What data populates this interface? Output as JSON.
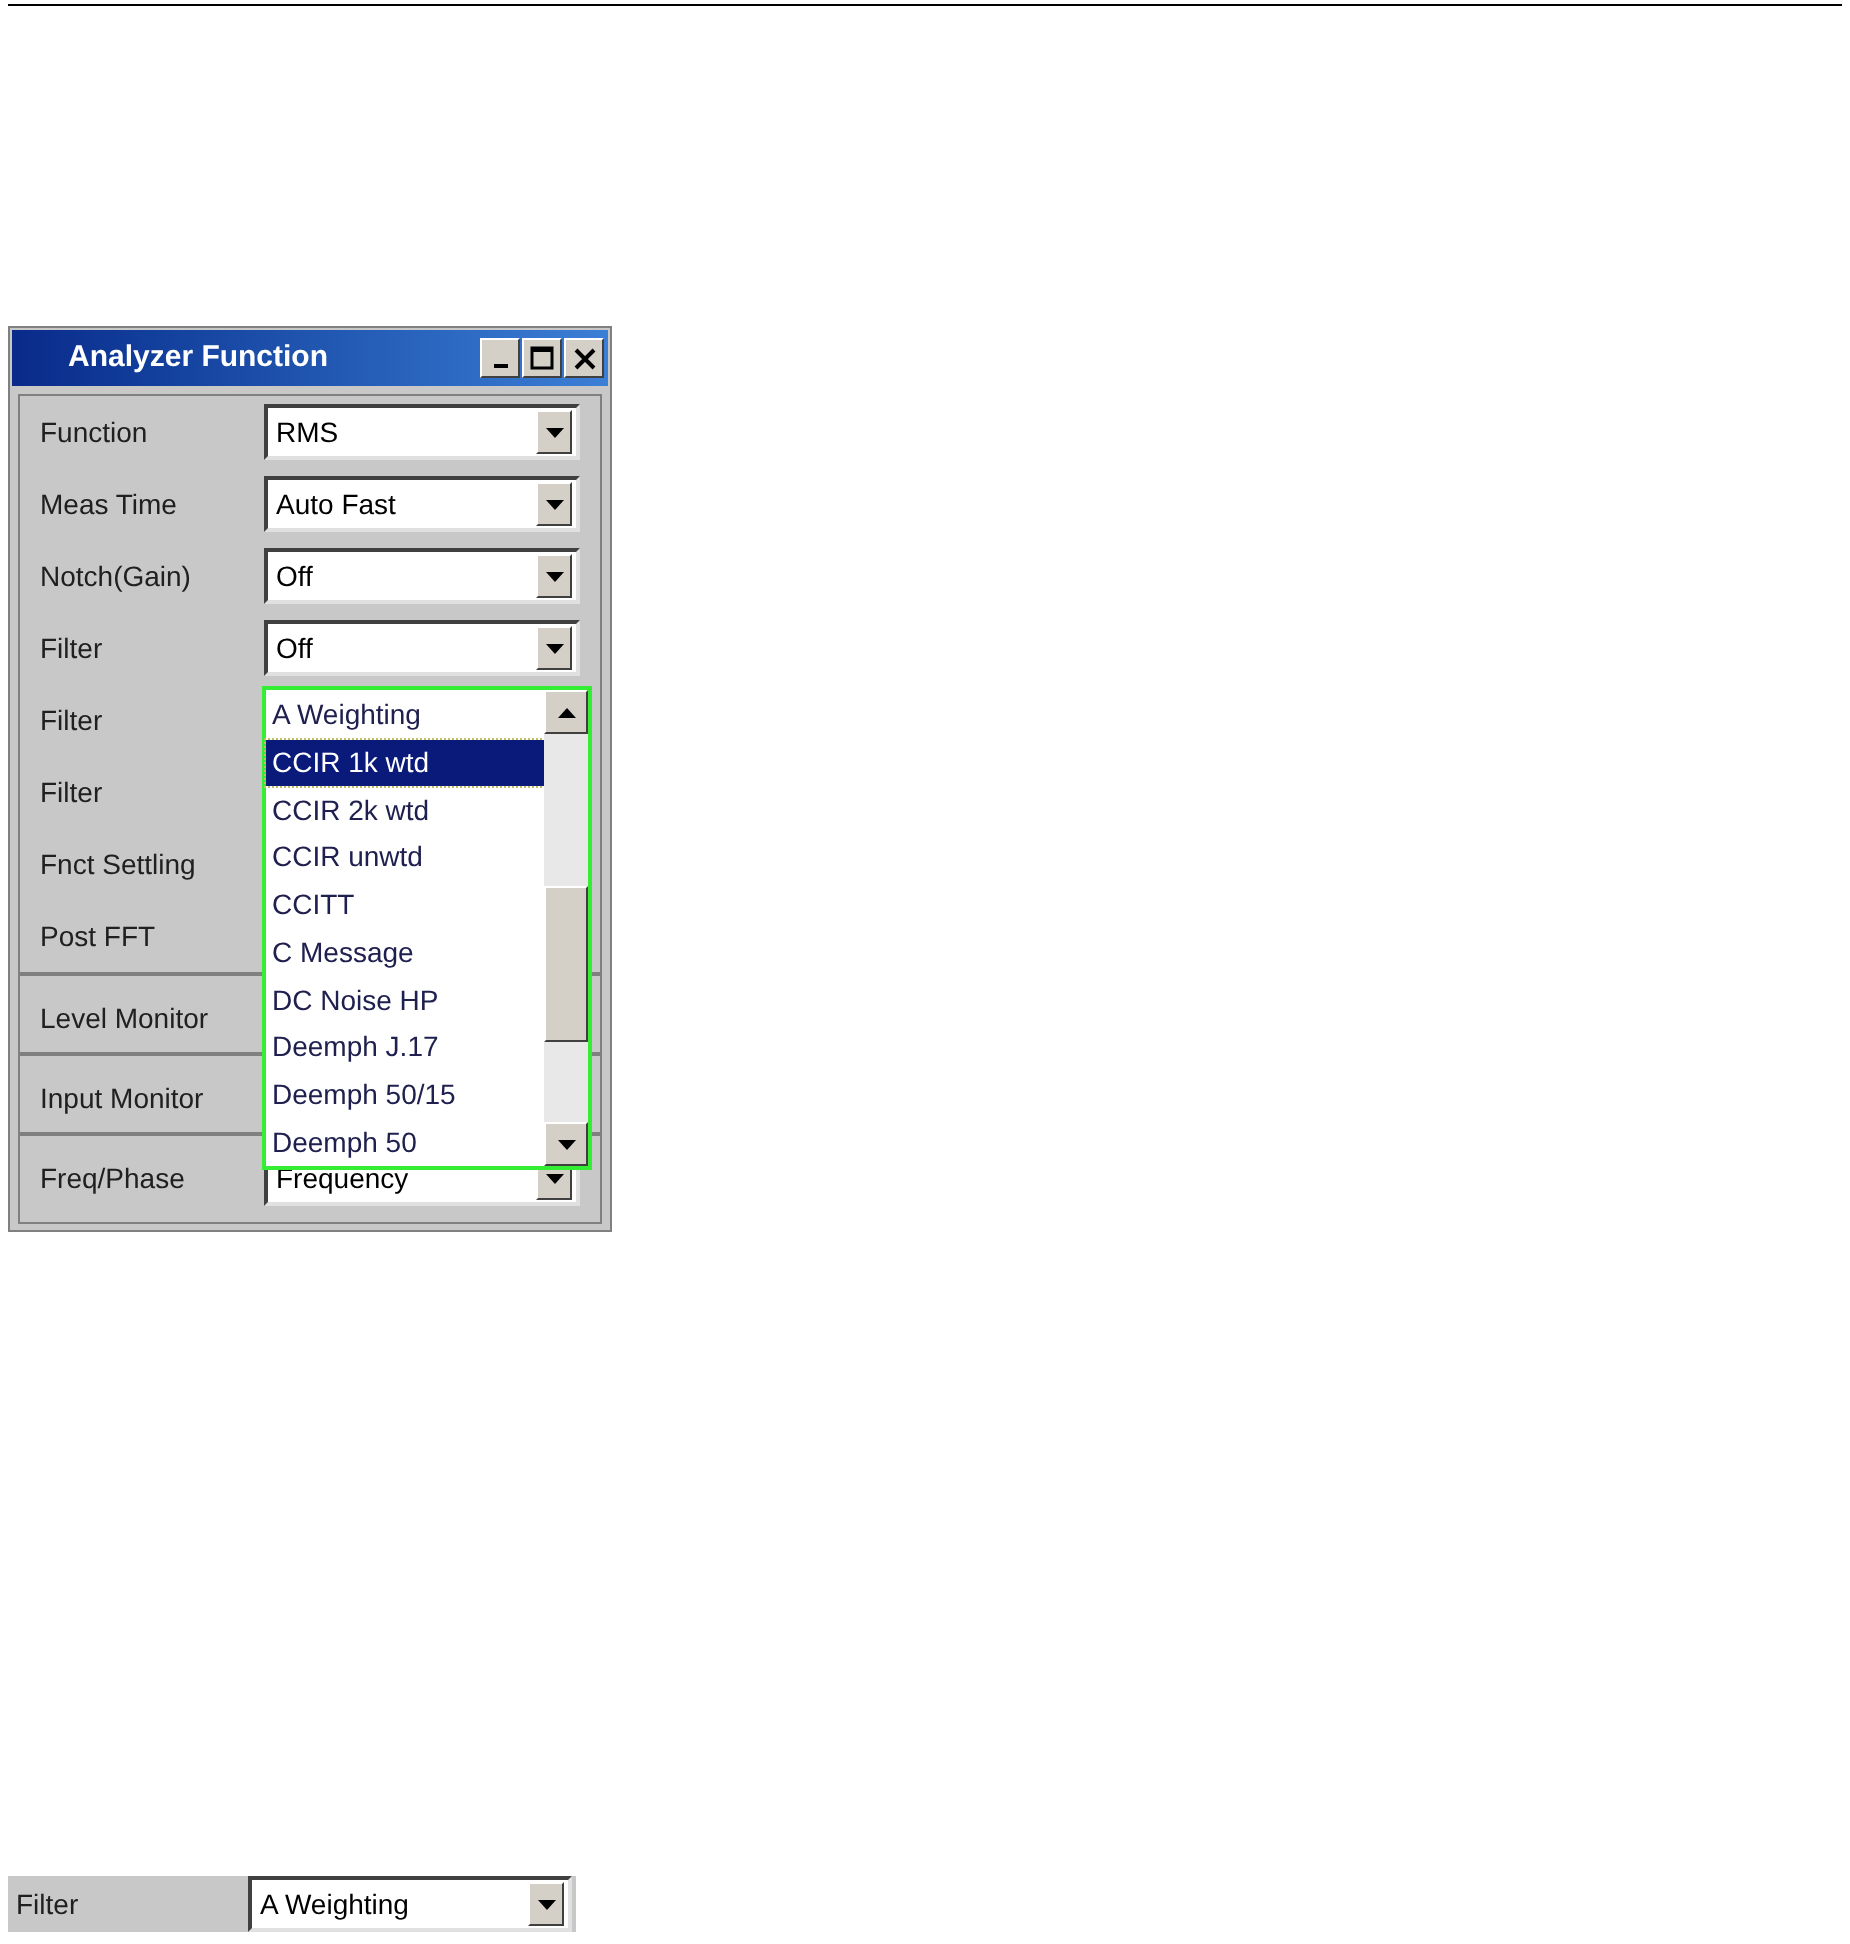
{
  "window": {
    "title": "Analyzer Function"
  },
  "rows": [
    {
      "label": "Function",
      "value": "RMS",
      "separator_above": false
    },
    {
      "label": "Meas Time",
      "value": "Auto Fast",
      "separator_above": false
    },
    {
      "label": "Notch(Gain)",
      "value": "Off",
      "separator_above": false
    },
    {
      "label": "Filter",
      "value": "Off",
      "separator_above": false
    },
    {
      "label": "Filter",
      "separator_above": false
    },
    {
      "label": "Filter",
      "separator_above": false
    },
    {
      "label": "Fnct Settling",
      "separator_above": false
    },
    {
      "label": "Post FFT",
      "separator_above": false
    },
    {
      "label": "Level Monitor",
      "separator_above": true
    },
    {
      "label": "Input Monitor",
      "separator_above": true
    },
    {
      "label": "Freq/Phase",
      "value": "Frequency",
      "separator_above": true
    }
  ],
  "dropdown_list": {
    "items": [
      {
        "label": "A Weighting",
        "selected": false
      },
      {
        "label": "CCIR 1k wtd",
        "selected": true
      },
      {
        "label": "CCIR 2k wtd",
        "selected": false
      },
      {
        "label": "CCIR unwtd",
        "selected": false
      },
      {
        "label": "CCITT",
        "selected": false
      },
      {
        "label": "C Message",
        "selected": false
      },
      {
        "label": "DC Noise HP",
        "selected": false
      },
      {
        "label": "Deemph J.17",
        "selected": false
      },
      {
        "label": "Deemph 50/15",
        "selected": false
      },
      {
        "label": "Deemph 50",
        "selected": false
      }
    ]
  },
  "example_row": {
    "label": "Filter",
    "value": "A Weighting"
  }
}
